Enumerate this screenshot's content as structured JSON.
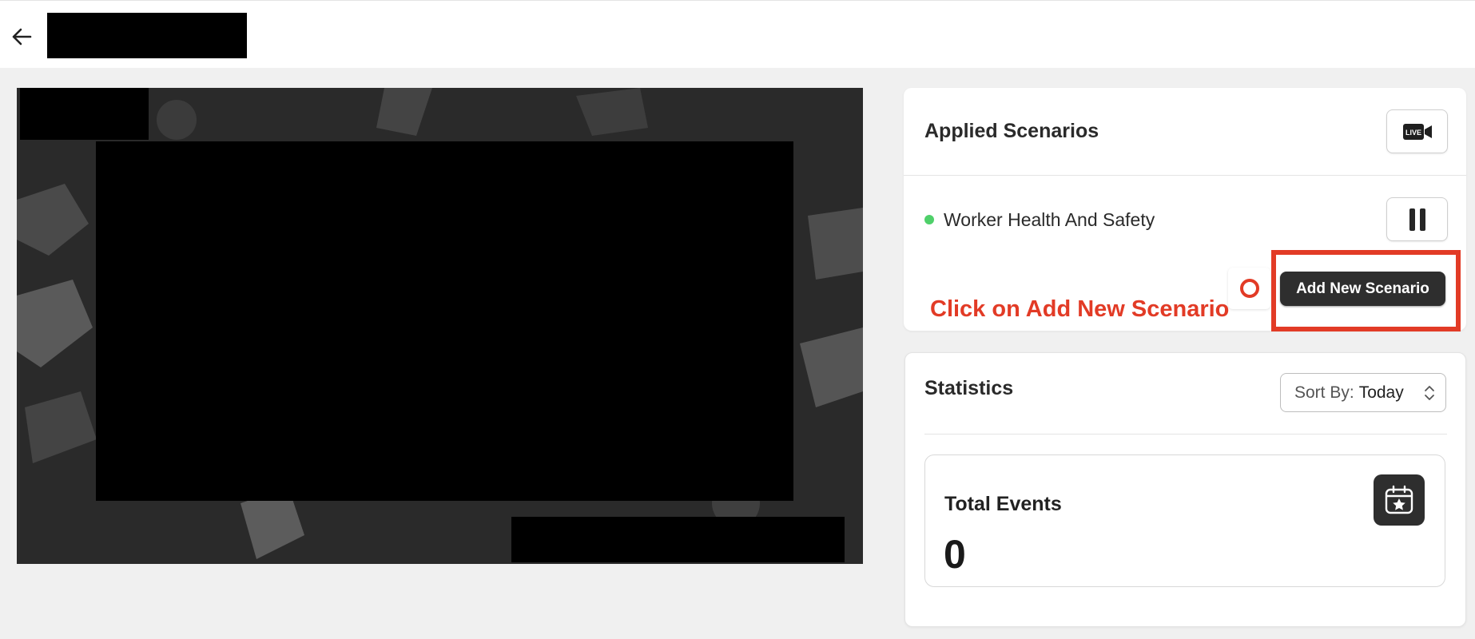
{
  "header": {
    "back_icon": "arrow-left-icon"
  },
  "applied_scenarios": {
    "title": "Applied Scenarios",
    "live_icon": "live-camera-icon",
    "live_badge": "LIVE",
    "items": [
      {
        "label": "Worker Health And Safety",
        "status_color": "#4fd06a",
        "action_icon": "pause-icon"
      }
    ],
    "add_button_label": "Add New Scenario"
  },
  "annotation": {
    "instruction": "Click on Add New Scenario",
    "color": "#e23b26"
  },
  "statistics": {
    "title": "Statistics",
    "sort": {
      "prefix": "Sort By:",
      "value": "Today"
    },
    "total_events": {
      "label": "Total Events",
      "value": "0",
      "icon": "calendar-star-icon"
    }
  }
}
